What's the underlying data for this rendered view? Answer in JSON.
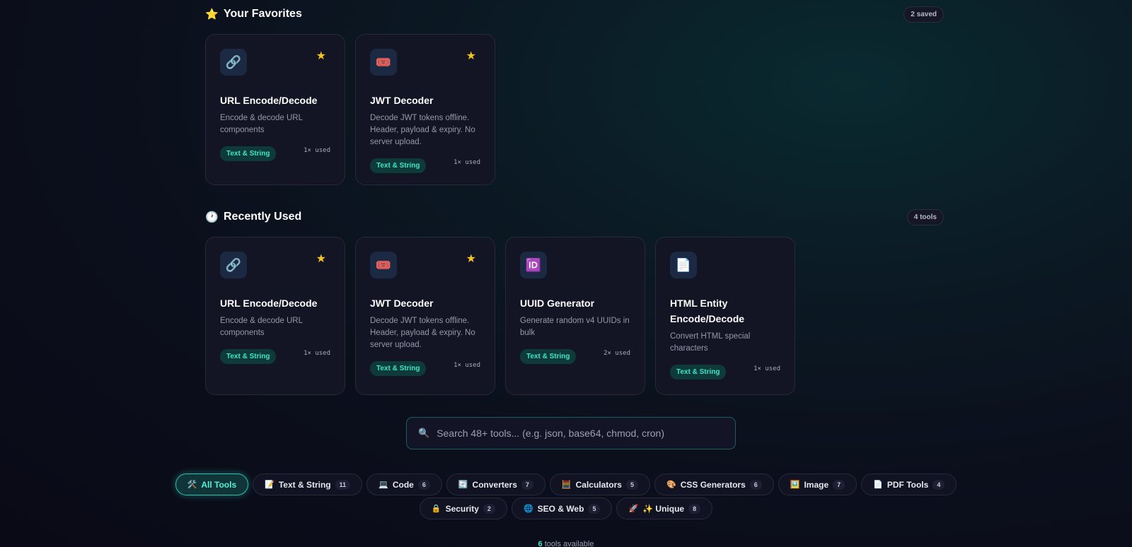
{
  "favorites": {
    "icon": "⭐",
    "title": "Your Favorites",
    "badge": "2 saved",
    "cards": [
      {
        "icon": "🔗",
        "title": "URL Encode/Decode",
        "desc": "Encode & decode URL components",
        "tag": "Text & String",
        "used": "1× used",
        "starred": true
      },
      {
        "icon": "🎟️",
        "title": "JWT Decoder",
        "desc": "Decode JWT tokens offline. Header, payload & expiry. No server upload.",
        "tag": "Text & String",
        "used": "1× used",
        "starred": true
      }
    ]
  },
  "recent": {
    "icon": "🕐",
    "title": "Recently Used",
    "badge": "4 tools",
    "cards": [
      {
        "icon": "🔗",
        "title": "URL Encode/Decode",
        "desc": "Encode & decode URL components",
        "tag": "Text & String",
        "used": "1× used",
        "starred": true
      },
      {
        "icon": "🎟️",
        "title": "JWT Decoder",
        "desc": "Decode JWT tokens offline. Header, payload & expiry. No server upload.",
        "tag": "Text & String",
        "used": "1× used",
        "starred": true
      },
      {
        "icon": "🆔",
        "title": "UUID Generator",
        "desc": "Generate random v4 UUIDs in bulk",
        "tag": "Text & String",
        "used": "2× used",
        "starred": false
      },
      {
        "icon": "📄",
        "title": "HTML Entity Encode/Decode",
        "desc": "Convert HTML special characters",
        "tag": "Text & String",
        "used": "1× used",
        "starred": false
      }
    ]
  },
  "search": {
    "icon": "🔍",
    "placeholder": "Search 48+ tools... (e.g. json, base64, chmod, cron)"
  },
  "categories": {
    "row1": [
      {
        "icon": "🛠️",
        "label": "All Tools",
        "count": "",
        "active": true
      },
      {
        "icon": "📝",
        "label": "Text & String",
        "count": "11"
      },
      {
        "icon": "💻",
        "label": "Code",
        "count": "6"
      },
      {
        "icon": "🔄",
        "label": "Converters",
        "count": "7"
      },
      {
        "icon": "🧮",
        "label": "Calculators",
        "count": "5"
      },
      {
        "icon": "🎨",
        "label": "CSS Generators",
        "count": "6"
      },
      {
        "icon": "🖼️",
        "label": "Image",
        "count": "7"
      },
      {
        "icon": "📄",
        "label": "PDF Tools",
        "count": "4"
      }
    ],
    "row2": [
      {
        "icon": "🔒",
        "label": "Security",
        "count": "2"
      },
      {
        "icon": "🌐",
        "label": "SEO & Web",
        "count": "5"
      },
      {
        "icon": "🚀",
        "label": "✨ Unique",
        "count": "8"
      }
    ]
  },
  "footer": {
    "count": "6",
    "text": "tools available"
  }
}
